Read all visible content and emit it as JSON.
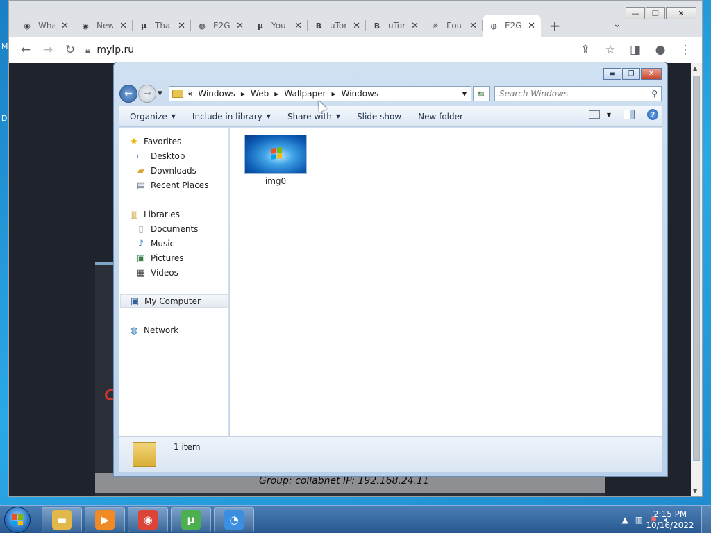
{
  "desktop": {
    "edge_letters": [
      "M",
      "D"
    ]
  },
  "browser": {
    "window_buttons": {
      "minimize": "—",
      "restore": "❐",
      "close": "✕"
    },
    "tabs": [
      {
        "icon": "chrome-icon",
        "glyph": "◉",
        "title": "What",
        "active": false
      },
      {
        "icon": "chrome-icon",
        "glyph": "◉",
        "title": "New",
        "active": false
      },
      {
        "icon": "utorrent-icon",
        "glyph": "μ",
        "title": "Tha",
        "active": false
      },
      {
        "icon": "globe-icon",
        "glyph": "◍",
        "title": "E2G",
        "active": false
      },
      {
        "icon": "utorrent-icon",
        "glyph": "μ",
        "title": "You",
        "active": false
      },
      {
        "icon": "b-icon",
        "glyph": "B",
        "title": "uTor",
        "active": false
      },
      {
        "icon": "b-icon",
        "glyph": "B",
        "title": "uTor",
        "active": false
      },
      {
        "icon": "spider-icon",
        "glyph": "✳",
        "title": "Гов",
        "active": false
      },
      {
        "icon": "globe-icon",
        "glyph": "◍",
        "title": "E2G",
        "active": true
      }
    ],
    "tab_close": "✕",
    "new_tab": "+",
    "tab_search": "⌄",
    "url": "mylp.ru",
    "page": {
      "info_text": "Group: collabnet    IP: 192.168.24.11"
    }
  },
  "explorer": {
    "caption_buttons": {
      "minimize": "▬",
      "maximize": "❐",
      "close": "✕"
    },
    "breadcrumbs": [
      "Windows",
      "Web",
      "Wallpaper",
      "Windows"
    ],
    "overflow": "«",
    "search_placeholder": "Search Windows",
    "commands": [
      {
        "name": "organize",
        "label": "Organize",
        "dropdown": true
      },
      {
        "name": "include-in-library",
        "label": "Include in library",
        "dropdown": true
      },
      {
        "name": "share-with",
        "label": "Share with",
        "dropdown": true
      },
      {
        "name": "slide-show",
        "label": "Slide show",
        "dropdown": false
      },
      {
        "name": "new-folder",
        "label": "New folder",
        "dropdown": false
      }
    ],
    "help": "?",
    "nav": {
      "favorites": {
        "label": "Favorites",
        "icon": "star-icon"
      },
      "favorites_items": [
        {
          "label": "Desktop",
          "icon": "desktop-icon"
        },
        {
          "label": "Downloads",
          "icon": "downloads-folder-icon"
        },
        {
          "label": "Recent Places",
          "icon": "recent-places-icon"
        }
      ],
      "libraries": {
        "label": "Libraries",
        "icon": "libraries-icon"
      },
      "libraries_items": [
        {
          "label": "Documents",
          "icon": "documents-icon"
        },
        {
          "label": "Music",
          "icon": "music-icon"
        },
        {
          "label": "Pictures",
          "icon": "pictures-icon"
        },
        {
          "label": "Videos",
          "icon": "videos-icon"
        }
      ],
      "computer": {
        "label": "My Computer",
        "icon": "computer-icon"
      },
      "network": {
        "label": "Network",
        "icon": "network-icon"
      }
    },
    "files": [
      {
        "name": "img0"
      }
    ],
    "details": {
      "count": "1 item"
    }
  },
  "taskbar": {
    "pinned": [
      {
        "name": "explorer",
        "icon": "folder-icon",
        "color": "#e2b84a"
      },
      {
        "name": "media-player",
        "icon": "media-player-icon",
        "color": "#f08a24"
      },
      {
        "name": "chrome",
        "icon": "chrome-icon",
        "color": "#db4437"
      },
      {
        "name": "utorrent",
        "icon": "utorrent-icon",
        "color": "#4caf50"
      },
      {
        "name": "vpn-client",
        "icon": "shield-lock-icon",
        "color": "#3b8ee0"
      }
    ],
    "clock": {
      "time": "2:15 PM",
      "date": "10/16/2022"
    }
  },
  "colors": {
    "chrome_frame": "#dee1e6",
    "explorer_frame": "#cfe0f1",
    "taskbar": "#27588f",
    "close_red": "#c7452d"
  }
}
